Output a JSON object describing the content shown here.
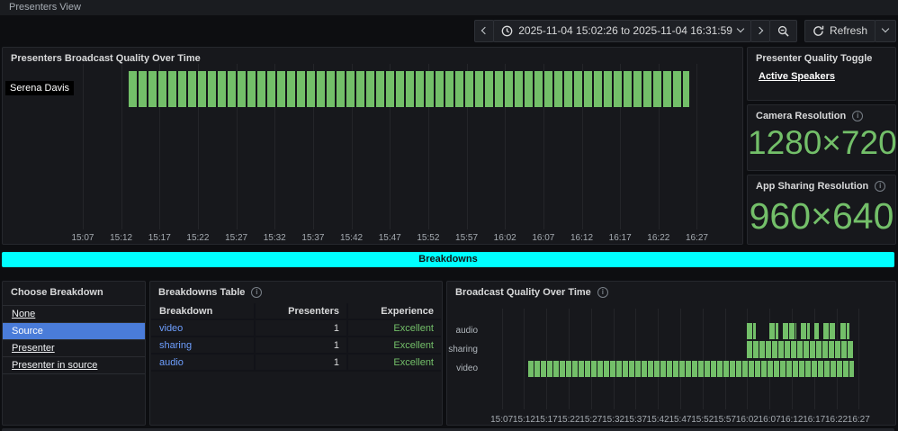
{
  "nav": {
    "title": "Presenters View"
  },
  "toolbar": {
    "time_range": "2025-11-04 15:02:26 to 2025-11-04 16:31:59",
    "refresh_label": "Refresh",
    "icons": [
      "chevron-left-icon",
      "clock-icon",
      "chevron-down-icon",
      "chevron-right-icon",
      "zoom-out-icon",
      "refresh-icon"
    ]
  },
  "colors": {
    "status_green": "#73BF69",
    "stat_green": "#73BF69",
    "row_cyan": "#00ffff",
    "selected_blue": "#4a7cd9",
    "link_blue": "#6e9fff",
    "panel_bg": "#17181c"
  },
  "panels": {
    "quality_toggle": {
      "title": "Presenter Quality Toggle",
      "link_label": "Active Speakers"
    },
    "camera_resolution": {
      "title": "Camera Resolution",
      "value": "1280×720",
      "info_icon": "info-icon"
    },
    "app_sharing_resolution": {
      "title": "App Sharing Resolution",
      "value": "960×640",
      "info_icon": "info-icon"
    },
    "breakdowns_row": {
      "label": "Breakdowns"
    },
    "choose_breakdown": {
      "title": "Choose Breakdown",
      "options": [
        {
          "label": "None",
          "selected": false
        },
        {
          "label": "Source",
          "selected": true
        },
        {
          "label": "Presenter",
          "selected": false
        },
        {
          "label": "Presenter in source",
          "selected": false
        }
      ]
    },
    "breakdowns_table": {
      "title": "Breakdowns Table",
      "info_icon": "info-icon",
      "columns": [
        "Breakdown",
        "Presenters",
        "Experience"
      ],
      "rows": [
        {
          "breakdown": "video",
          "presenters": "1",
          "experience": "Excellent"
        },
        {
          "breakdown": "sharing",
          "presenters": "1",
          "experience": "Excellent"
        },
        {
          "breakdown": "audio",
          "presenters": "1",
          "experience": "Excellent"
        }
      ]
    }
  },
  "chart_data": [
    {
      "type": "bar",
      "subtype": "status-history-timeline",
      "title": "Presenters Broadcast Quality Over Time",
      "time_domain": [
        "15:02:26",
        "16:31:59"
      ],
      "x_ticks": [
        "15:07",
        "15:12",
        "15:17",
        "15:22",
        "15:27",
        "15:32",
        "15:37",
        "15:42",
        "15:47",
        "15:52",
        "15:57",
        "16:02",
        "16:07",
        "16:12",
        "16:17",
        "16:22",
        "16:27"
      ],
      "categories": [
        "Serena Davis"
      ],
      "series": [
        {
          "name": "Serena Davis",
          "status": "good",
          "color": "#73BF69",
          "segments": [
            [
              "15:13",
              "16:26"
            ]
          ]
        }
      ],
      "legend": false,
      "grid": true
    },
    {
      "type": "bar",
      "subtype": "status-history-timeline",
      "title": "Broadcast Quality Over Time",
      "info_icon": "info-icon",
      "time_domain": [
        "15:02:26",
        "16:31:59"
      ],
      "x_ticks": [
        "15:07",
        "15:12",
        "15:17",
        "15:22",
        "15:27",
        "15:32",
        "15:37",
        "15:42",
        "15:47",
        "15:52",
        "15:57",
        "16:02",
        "16:07",
        "16:12",
        "16:17",
        "16:22",
        "16:27"
      ],
      "categories": [
        "audio",
        "sharing",
        "video"
      ],
      "series": [
        {
          "name": "audio",
          "status": "good",
          "color": "#73BF69",
          "segments": [
            [
              "16:02",
              "16:04"
            ],
            [
              "16:07",
              "16:09"
            ],
            [
              "16:10",
              "16:13"
            ],
            [
              "16:14",
              "16:16"
            ],
            [
              "16:17",
              "16:18"
            ],
            [
              "16:19",
              "16:22"
            ],
            [
              "16:23",
              "16:25"
            ]
          ]
        },
        {
          "name": "sharing",
          "status": "good",
          "color": "#73BF69",
          "segments": [
            [
              "16:02",
              "16:26"
            ]
          ]
        },
        {
          "name": "video",
          "status": "good",
          "color": "#73BF69",
          "segments": [
            [
              "15:13",
              "16:26"
            ]
          ]
        }
      ],
      "legend": false,
      "grid": true
    }
  ]
}
